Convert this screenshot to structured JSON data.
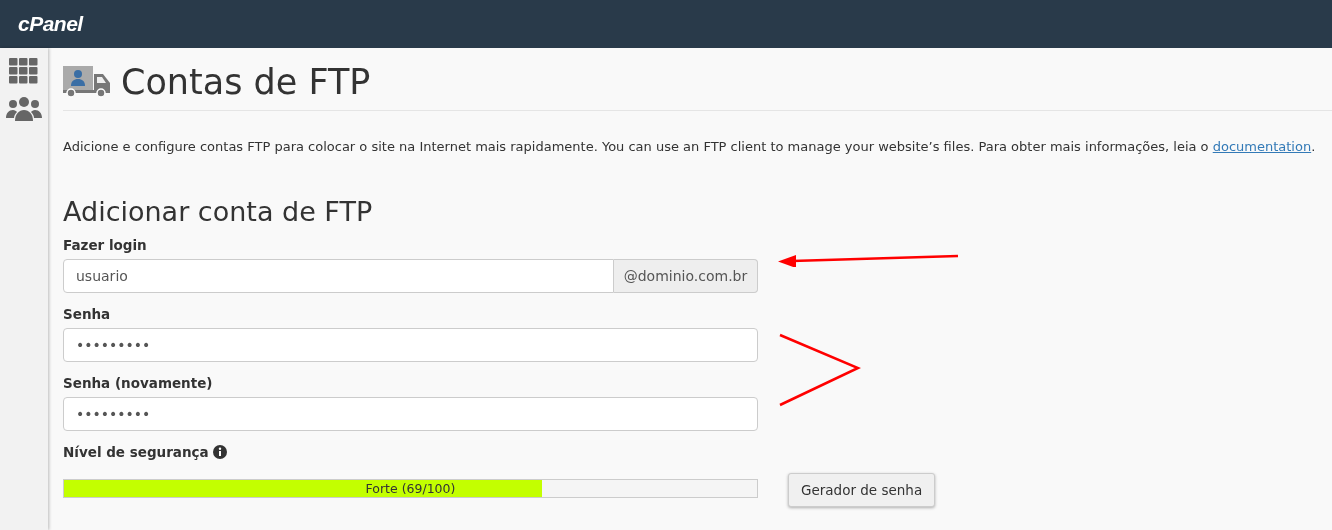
{
  "header": {
    "logo": "cPanel"
  },
  "page": {
    "title": "Contas de FTP",
    "description": "Adicione e configure contas FTP para colocar o site na Internet mais rapidamente. You can use an FTP client to manage your website’s files. Para obter mais informações, leia o ",
    "description_link": "documentation",
    "description_end": "."
  },
  "form": {
    "heading": "Adicionar conta de FTP",
    "fields": [
      {
        "kind": "login",
        "label": "Fazer login",
        "value": "usuario",
        "addon": "@dominio.com.br"
      },
      {
        "kind": "password",
        "label": "Senha",
        "value": "•••••••••"
      },
      {
        "kind": "password",
        "label": "Senha (novamente)",
        "value": "•••••••••"
      }
    ],
    "strength": {
      "label": "Nível de segurança",
      "level": 0.69,
      "reading": "Forte (69/100)"
    },
    "generator_button": "Gerador de senha"
  }
}
